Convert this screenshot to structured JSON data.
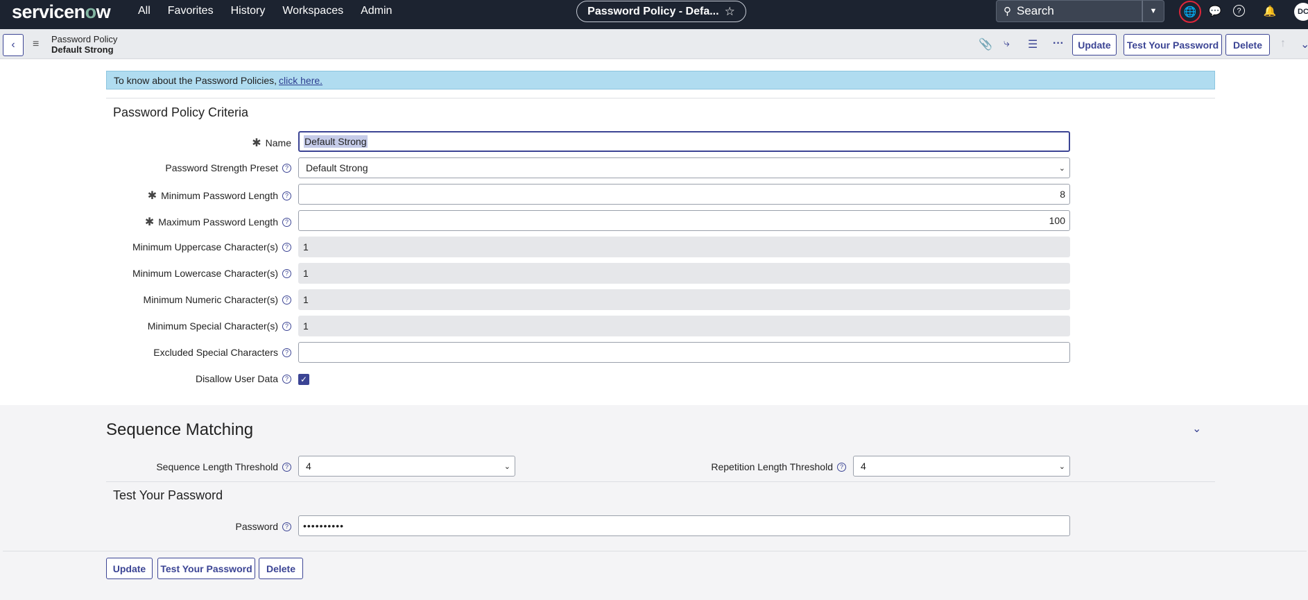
{
  "topnav": {
    "logo": "servicenow",
    "links": [
      "All",
      "Favorites",
      "History",
      "Workspaces",
      "Admin"
    ],
    "title": "Password Policy - Defa...",
    "search_placeholder": "Search",
    "avatar": "DC"
  },
  "header": {
    "table_name": "Password Policy",
    "record_name": "Default Strong",
    "update_label": "Update",
    "test_label": "Test Your Password",
    "delete_label": "Delete"
  },
  "info": {
    "text": "To know about the Password Policies,",
    "link": "click here."
  },
  "criteria": {
    "title": "Password Policy Criteria",
    "fields": [
      {
        "label": "Name",
        "value": "Default Strong"
      },
      {
        "label": "Password Strength Preset",
        "value": "Default Strong"
      },
      {
        "label": "Minimum Password Length",
        "value": "8"
      },
      {
        "label": "Maximum Password Length",
        "value": "100"
      },
      {
        "label": "Minimum Uppercase Character(s)",
        "value": "1"
      },
      {
        "label": "Minimum Lowercase Character(s)",
        "value": "1"
      },
      {
        "label": "Minimum Numeric Character(s)",
        "value": "1"
      },
      {
        "label": "Minimum Special Character(s)",
        "value": "1"
      },
      {
        "label": "Excluded Special Characters",
        "value": ""
      },
      {
        "label": "Disallow User Data",
        "value": "true"
      }
    ]
  },
  "sequence": {
    "title": "Sequence Matching",
    "seq_label": "Sequence Length Threshold",
    "seq_value": "4",
    "rep_label": "Repetition Length Threshold",
    "rep_value": "4"
  },
  "test": {
    "title": "Test Your Password",
    "label": "Password",
    "value": "••••••••••"
  },
  "colors": {
    "nav_bg": "#1c2330",
    "accent": "#3b4494",
    "info_bg": "#b0dcf0"
  }
}
